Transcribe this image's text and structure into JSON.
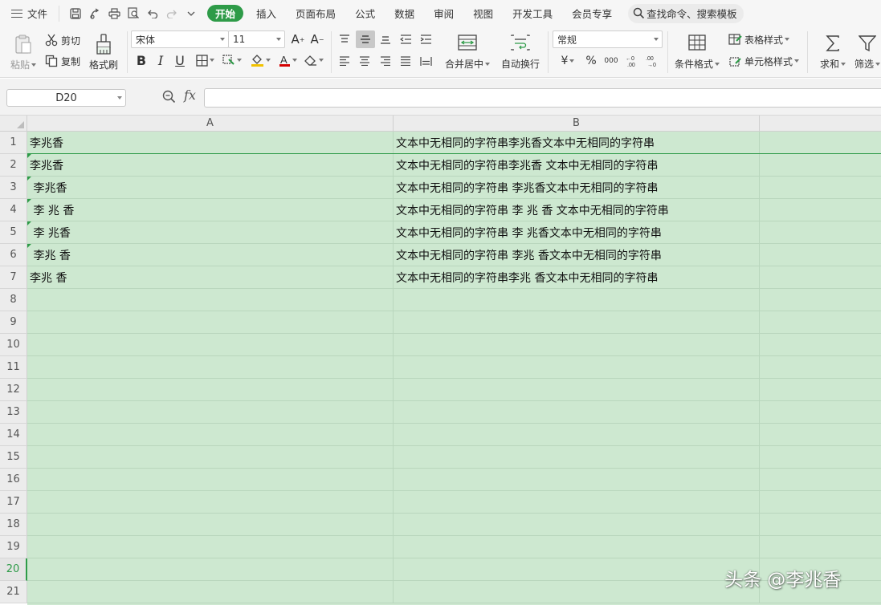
{
  "menu": {
    "file_label": "文件",
    "tabs": [
      "开始",
      "插入",
      "页面布局",
      "公式",
      "数据",
      "审阅",
      "视图",
      "开发工具",
      "会员专享"
    ],
    "search_placeholder": "查找命令、搜索模板"
  },
  "ribbon": {
    "paste": "粘贴",
    "cut": "剪切",
    "copy": "复制",
    "format_painter": "格式刷",
    "font_name": "宋体",
    "font_size": "11",
    "bold": "B",
    "italic": "I",
    "underline": "U",
    "merge_center": "合并居中",
    "wrap_text": "自动换行",
    "number_format": "常规",
    "currency": "¥",
    "percent": "%",
    "thousands": "000",
    "conditional_format": "条件格式",
    "table_style": "表格样式",
    "cell_style": "单元格样式",
    "sum": "求和",
    "filter": "筛选"
  },
  "formula_bar": {
    "name_box": "D20",
    "fx": "fx",
    "content": ""
  },
  "columns": [
    "A",
    "B"
  ],
  "rows": [
    {
      "num": "1",
      "a": "李兆香",
      "b": "文本中无相同的字符串李兆香文本中无相同的字符串",
      "flag": false
    },
    {
      "num": "2",
      "a": "李兆香",
      "b": "文本中无相同的字符串李兆香 文本中无相同的字符串",
      "flag": true
    },
    {
      "num": "3",
      "a": " 李兆香",
      "b": "文本中无相同的字符串 李兆香文本中无相同的字符串",
      "flag": true
    },
    {
      "num": "4",
      "a": " 李 兆 香",
      "b": "文本中无相同的字符串 李 兆 香 文本中无相同的字符串",
      "flag": true
    },
    {
      "num": "5",
      "a": " 李 兆香",
      "b": "文本中无相同的字符串 李 兆香文本中无相同的字符串",
      "flag": true
    },
    {
      "num": "6",
      "a": " 李兆 香",
      "b": "文本中无相同的字符串 李兆 香文本中无相同的字符串",
      "flag": true
    },
    {
      "num": "7",
      "a": "李兆 香",
      "b": "文本中无相同的字符串李兆 香文本中无相同的字符串",
      "flag": false
    },
    {
      "num": "8",
      "a": "",
      "b": "",
      "flag": false
    },
    {
      "num": "9",
      "a": "",
      "b": "",
      "flag": false
    },
    {
      "num": "10",
      "a": "",
      "b": "",
      "flag": false
    },
    {
      "num": "11",
      "a": "",
      "b": "",
      "flag": false
    },
    {
      "num": "12",
      "a": "",
      "b": "",
      "flag": false
    },
    {
      "num": "13",
      "a": "",
      "b": "",
      "flag": false
    },
    {
      "num": "14",
      "a": "",
      "b": "",
      "flag": false
    },
    {
      "num": "15",
      "a": "",
      "b": "",
      "flag": false
    },
    {
      "num": "16",
      "a": "",
      "b": "",
      "flag": false
    },
    {
      "num": "17",
      "a": "",
      "b": "",
      "flag": false
    },
    {
      "num": "18",
      "a": "",
      "b": "",
      "flag": false
    },
    {
      "num": "19",
      "a": "",
      "b": "",
      "flag": false
    },
    {
      "num": "20",
      "a": "",
      "b": "",
      "flag": false
    },
    {
      "num": "21",
      "a": "",
      "b": "",
      "flag": false
    }
  ],
  "selected_row": "20",
  "watermark": "头条 @李兆香",
  "colors": {
    "accent": "#2e9b48",
    "cell_fill": "#cde8d0"
  }
}
